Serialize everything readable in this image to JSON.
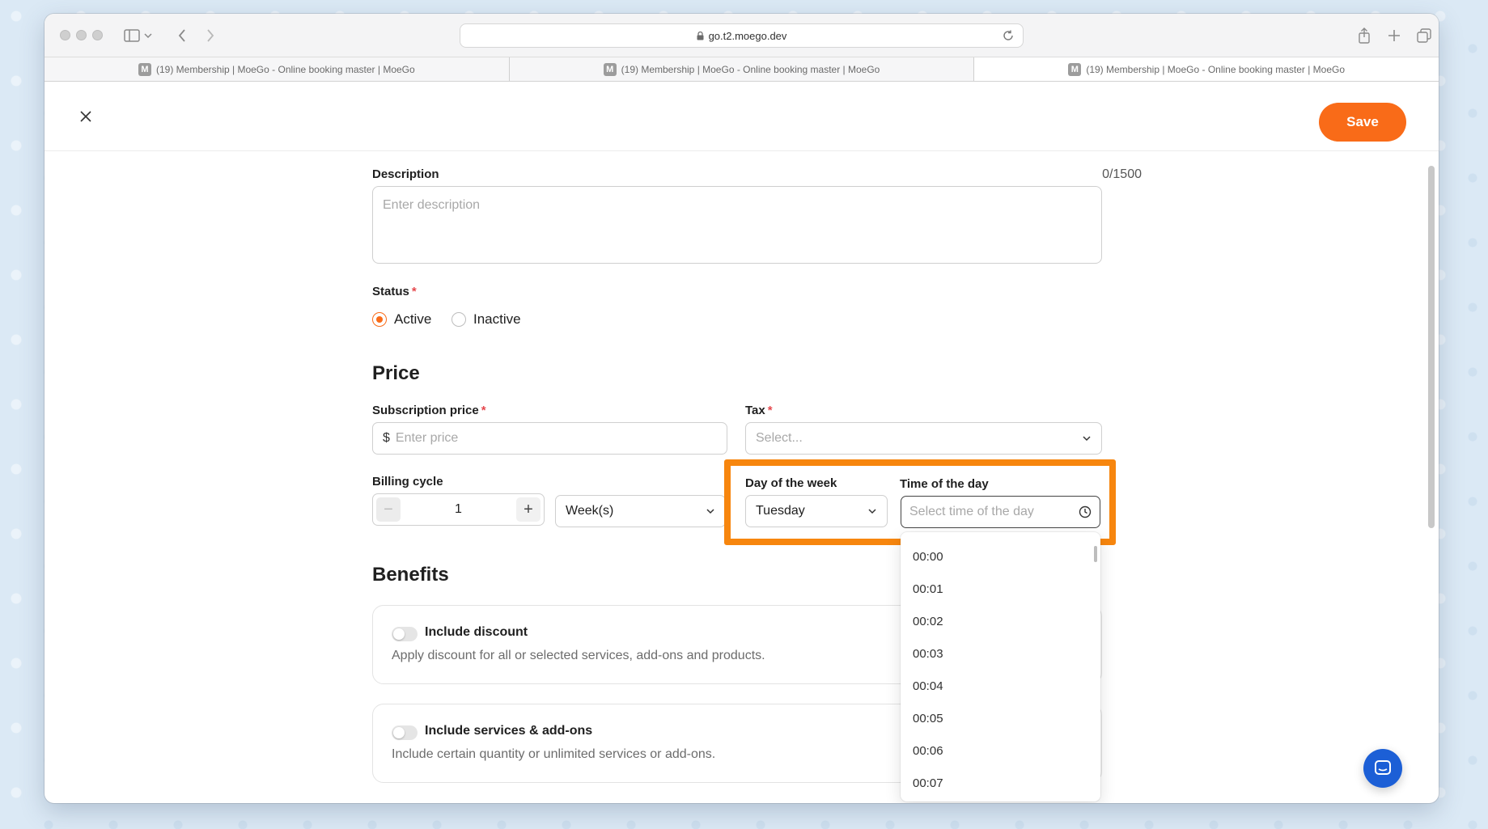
{
  "browser": {
    "url": "go.t2.moego.dev",
    "tabs": [
      {
        "label": "(19) Membership | MoeGo - Online booking master | MoeGo",
        "favicon": "M"
      },
      {
        "label": "(19) Membership | MoeGo - Online booking master | MoeGo",
        "favicon": "M"
      },
      {
        "label": "(19) Membership | MoeGo - Online booking master | MoeGo",
        "favicon": "M"
      }
    ]
  },
  "header": {
    "save_label": "Save"
  },
  "description": {
    "label": "Description",
    "counter": "0/1500",
    "placeholder": "Enter description"
  },
  "status": {
    "label": "Status",
    "required_mark": "*",
    "options": [
      "Active",
      "Inactive"
    ],
    "selected": "Active"
  },
  "price": {
    "heading": "Price",
    "subscription": {
      "label": "Subscription price",
      "required_mark": "*",
      "currency": "$",
      "placeholder": "Enter price"
    },
    "tax": {
      "label": "Tax",
      "required_mark": "*",
      "placeholder": "Select..."
    }
  },
  "billing": {
    "label": "Billing cycle",
    "minus": "−",
    "plus": "+",
    "quantity": "1",
    "unit": "Week(s)",
    "day_label": "Day of the week",
    "day_value": "Tuesday",
    "time_label": "Time of the day",
    "time_placeholder": "Select time of the day"
  },
  "time_options": [
    "00:00",
    "00:01",
    "00:02",
    "00:03",
    "00:04",
    "00:05",
    "00:06",
    "00:07"
  ],
  "benefits": {
    "heading": "Benefits",
    "cards": [
      {
        "title": "Include discount",
        "desc": "Apply discount for all or selected services, add-ons and products."
      },
      {
        "title": "Include services & add-ons",
        "desc": "Include certain quantity or unlimited services or add-ons."
      }
    ]
  },
  "colors": {
    "accent": "#f96b18",
    "highlight": "#f7860e",
    "chat": "#1c5fd6"
  }
}
